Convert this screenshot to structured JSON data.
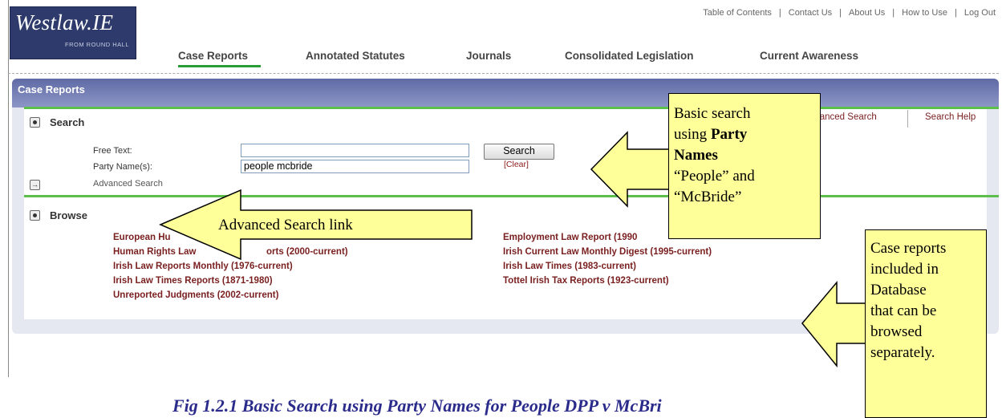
{
  "logo": {
    "main": "Westlaw.IE",
    "sub": "FROM ROUND HALL"
  },
  "top_links": [
    "Table of Contents",
    "Contact Us",
    "About Us",
    "How to Use",
    "Log Out"
  ],
  "nav": [
    "Case Reports",
    "Annotated Statutes",
    "Journals",
    "Consolidated Legislation",
    "Current Awareness"
  ],
  "panel": {
    "title": "Case Reports",
    "search_section": "Search",
    "advanced_search_link_right": "vanced Search",
    "search_help_link": "Search Help",
    "free_text_label": "Free Text:",
    "free_text_value": "",
    "party_names_label": "Party Name(s):",
    "party_names_value": "people mcbride",
    "search_button": "Search",
    "clear_link": "[Clear]",
    "advanced_search_label": "Advanced Search",
    "browse_section": "Browse",
    "browse_left": [
      "European Hu",
      "Human Rights Law",
      "Irish Law Reports Monthly (1976-current)",
      "Irish Law Times Reports (1871-1980)",
      "Unreported Judgments (2002-current)"
    ],
    "browse_left_fragments": {
      "row2_tail": "orts (2000-current)"
    },
    "browse_right": [
      "Employment Law Report (1990",
      "Irish Current Law Monthly Digest (1995-current)",
      "Irish Law Times (1983-current)",
      "Tottel Irish Tax Reports (1923-current)"
    ]
  },
  "callouts": {
    "basic_search": {
      "line1": "Basic search",
      "line2_pre": "using ",
      "line2_bold": "Party",
      "line3_bold": "Names",
      "line4": "“People” and",
      "line5": "“McBride”"
    },
    "advanced_link": "Advanced Search link",
    "case_reports": [
      "Case reports",
      "included in",
      "Database",
      "that can be",
      "browsed",
      "separately."
    ]
  },
  "caption": "Fig 1.2.1 Basic Search using Party Names for People DPP v McBri"
}
